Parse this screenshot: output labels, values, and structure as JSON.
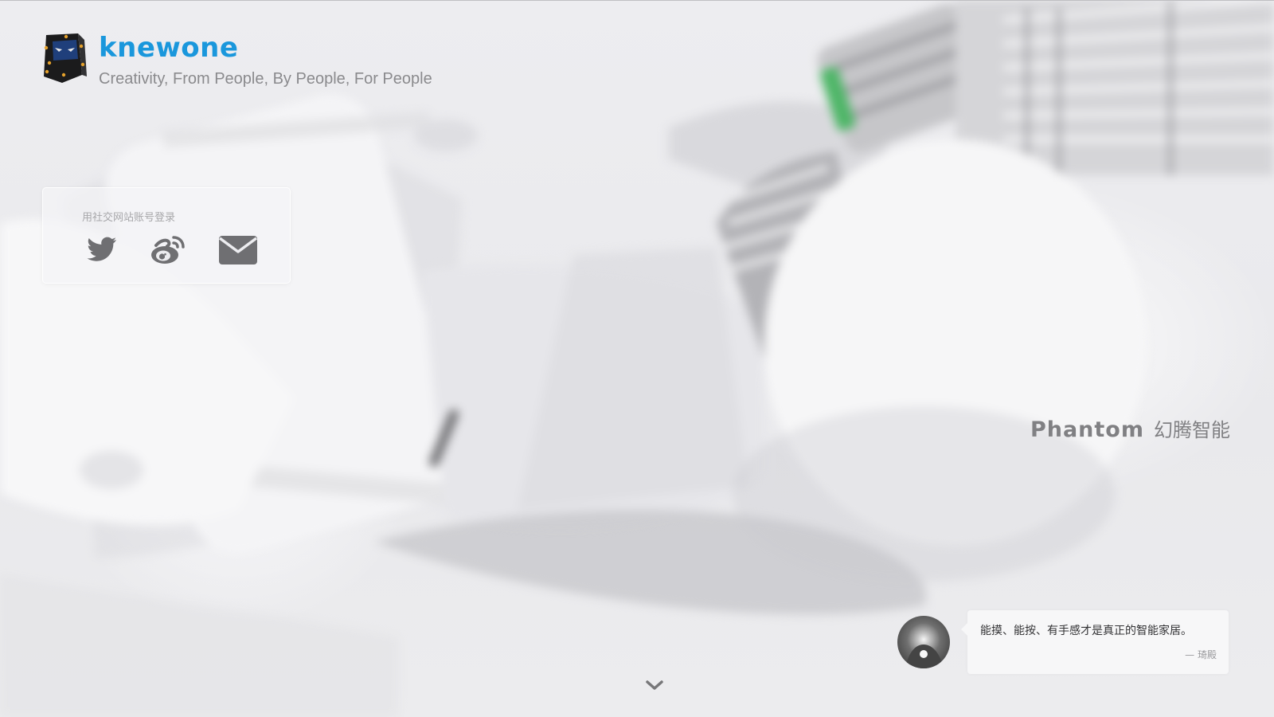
{
  "header": {
    "brand_name": "knewone",
    "tagline": "Creativity, From People, By People, For People"
  },
  "login": {
    "title": "用社交网站账号登录",
    "providers": [
      {
        "name": "twitter",
        "icon": "twitter-icon"
      },
      {
        "name": "weibo",
        "icon": "weibo-icon"
      },
      {
        "name": "email",
        "icon": "mail-icon"
      }
    ]
  },
  "feature": {
    "brand_en": "Phantom",
    "brand_cn": "幻腾智能"
  },
  "quote": {
    "text": "能摸、能按、有手感才是真正的智能家居。",
    "author": "— 琦殿"
  },
  "colors": {
    "brand_blue": "#1a97dc",
    "icon_gray": "#6f6f72",
    "text_gray": "#8a8a8d"
  }
}
